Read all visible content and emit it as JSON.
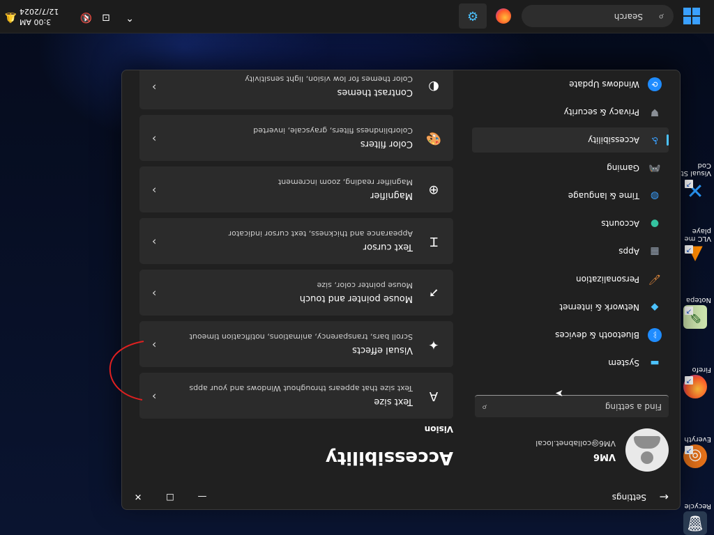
{
  "desktop": {
    "icons": [
      {
        "name": "recycle-bin",
        "label": "Recycle"
      },
      {
        "name": "everything",
        "label": "Everyth"
      },
      {
        "name": "firefox",
        "label": "Firefo"
      },
      {
        "name": "notepad",
        "label": "Notepa"
      },
      {
        "name": "vlc",
        "label": "VLC me\nplaye"
      },
      {
        "name": "vscode",
        "label": "Visual St\nCod"
      }
    ]
  },
  "window": {
    "title": "Settings",
    "user": {
      "name": "VM6",
      "email": "VM6@collabnet.local"
    },
    "search_placeholder": "Find a setting",
    "nav": [
      {
        "label": "System",
        "icon": "monitor-icon",
        "color": "#4cc2ff"
      },
      {
        "label": "Bluetooth & devices",
        "icon": "bluetooth-icon",
        "color": "#1f8cff"
      },
      {
        "label": "Network & internet",
        "icon": "wifi-icon",
        "color": "#4cc2ff"
      },
      {
        "label": "Personalization",
        "icon": "brush-icon",
        "color": "#e48a3c"
      },
      {
        "label": "Apps",
        "icon": "apps-icon",
        "color": "#9aa7b7"
      },
      {
        "label": "Accounts",
        "icon": "person-icon",
        "color": "#34c3a0"
      },
      {
        "label": "Time & language",
        "icon": "globe-icon",
        "color": "#3aa0ff"
      },
      {
        "label": "Gaming",
        "icon": "gamepad-icon",
        "color": "#9a9a9a"
      },
      {
        "label": "Accessibility",
        "icon": "accessibility-icon",
        "color": "#3aa0ff",
        "active": true
      },
      {
        "label": "Privacy & security",
        "icon": "shield-icon",
        "color": "#8a8f96"
      },
      {
        "label": "Windows Update",
        "icon": "update-icon",
        "color": "#1f8cff"
      }
    ],
    "page_title": "Accessibility",
    "section": "Vision",
    "cards": [
      {
        "title": "Text size",
        "subtitle": "Text size that appears throughout Windows and your apps",
        "icon": "text-size-icon"
      },
      {
        "title": "Visual effects",
        "subtitle": "Scroll bars, transparency, animations, notification timeout",
        "icon": "sparkle-icon"
      },
      {
        "title": "Mouse pointer and touch",
        "subtitle": "Mouse pointer color, size",
        "icon": "pointer-icon"
      },
      {
        "title": "Text cursor",
        "subtitle": "Appearance and thickness, text cursor indicator",
        "icon": "text-cursor-icon"
      },
      {
        "title": "Magnifier",
        "subtitle": "Magnifier reading, zoom increment",
        "icon": "magnifier-icon"
      },
      {
        "title": "Color filters",
        "subtitle": "Colorblindness filters, grayscale, inverted",
        "icon": "palette-icon"
      },
      {
        "title": "Contrast themes",
        "subtitle": "Color themes for low vision, light sensitivity",
        "icon": "contrast-icon"
      }
    ]
  },
  "taskbar": {
    "search_label": "Search",
    "time": "3:00 AM",
    "date": "12/7/2024"
  }
}
